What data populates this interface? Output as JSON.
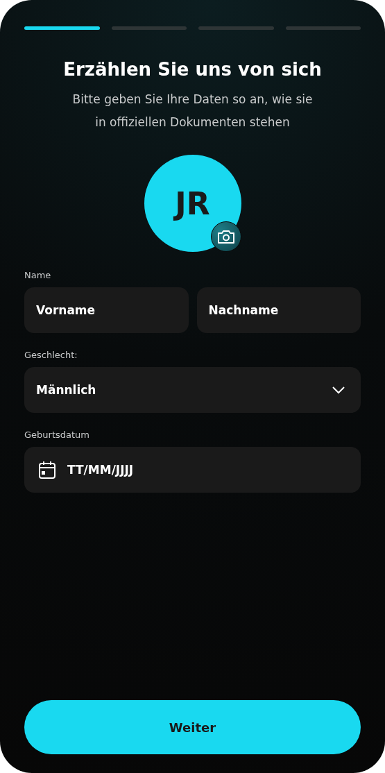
{
  "progress": [
    {
      "active": true
    },
    {
      "active": false
    },
    {
      "active": false
    },
    {
      "active": false
    }
  ],
  "title": "Erzählen Sie uns von sich",
  "subtitle": "Bitte geben Sie Ihre Daten so an, wie sie in offiziellen Dokumenten stehen",
  "avatar": {
    "initials": "JR"
  },
  "name": {
    "label": "Name",
    "first": {
      "placeholder": "Vorname"
    },
    "last": {
      "placeholder": "Nachname"
    }
  },
  "gender": {
    "label": "Geschlecht:",
    "value": "Männlich"
  },
  "birthdate": {
    "label": "Geburtsdatum",
    "placeholder": "TT/MM/JJJJ"
  },
  "submit": "Weiter"
}
